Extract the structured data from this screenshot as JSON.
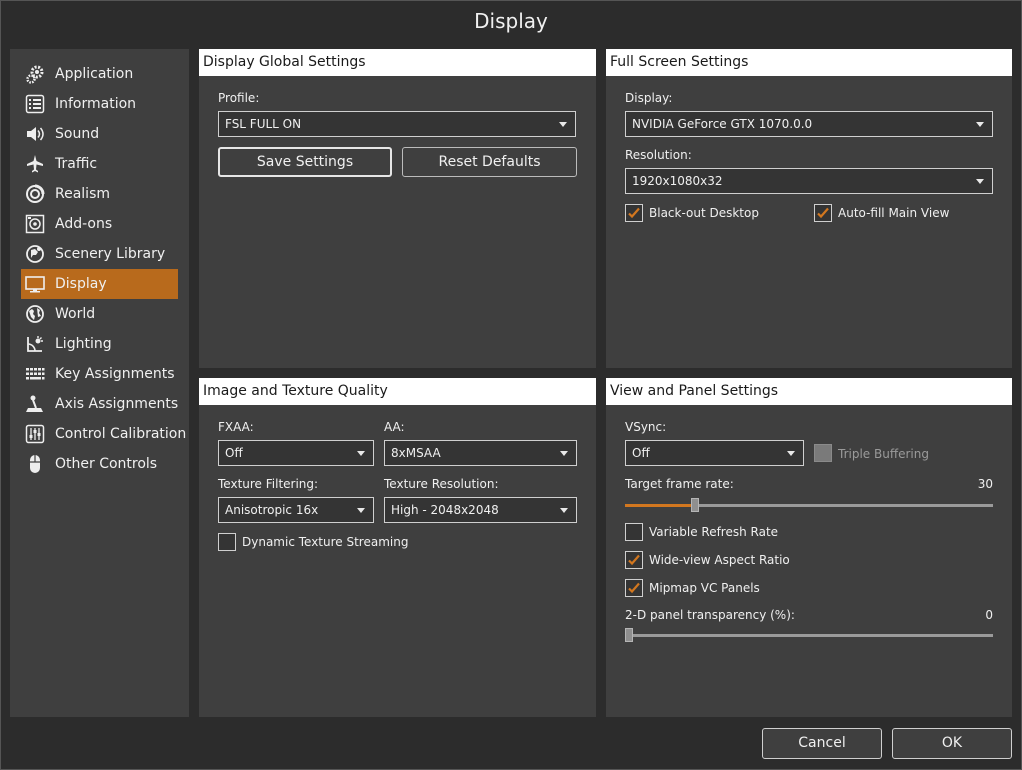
{
  "window": {
    "title": "Display"
  },
  "sidebar": {
    "active_color": "#b86a1c",
    "items": [
      {
        "label": "Application",
        "icon": "gears-icon"
      },
      {
        "label": "Information",
        "icon": "list-icon"
      },
      {
        "label": "Sound",
        "icon": "speaker-icon"
      },
      {
        "label": "Traffic",
        "icon": "airplane-icon"
      },
      {
        "label": "Realism",
        "icon": "realism-icon"
      },
      {
        "label": "Add-ons",
        "icon": "addons-icon"
      },
      {
        "label": "Scenery Library",
        "icon": "globe-pin-icon"
      },
      {
        "label": "Display",
        "icon": "monitor-icon",
        "active": true
      },
      {
        "label": "World",
        "icon": "world-icon"
      },
      {
        "label": "Lighting",
        "icon": "lighting-icon"
      },
      {
        "label": "Key Assignments",
        "icon": "keyboard-icon"
      },
      {
        "label": "Axis Assignments",
        "icon": "joystick-icon"
      },
      {
        "label": "Control Calibration",
        "icon": "sliders-icon"
      },
      {
        "label": "Other Controls",
        "icon": "mouse-icon"
      }
    ]
  },
  "global": {
    "header": "Display Global Settings",
    "profile_label": "Profile:",
    "profile_value": "FSL FULL ON",
    "save_button": "Save Settings",
    "reset_button": "Reset Defaults"
  },
  "fullscreen": {
    "header": "Full Screen Settings",
    "display_label": "Display:",
    "display_value": "NVIDIA GeForce GTX 1070.0.0",
    "resolution_label": "Resolution:",
    "resolution_value": "1920x1080x32",
    "blackout_label": "Black-out Desktop",
    "blackout_checked": true,
    "autofill_label": "Auto-fill Main View",
    "autofill_checked": true
  },
  "image": {
    "header": "Image and Texture Quality",
    "fxaa_label": "FXAA:",
    "fxaa_value": "Off",
    "aa_label": "AA:",
    "aa_value": "8xMSAA",
    "filtering_label": "Texture Filtering:",
    "filtering_value": "Anisotropic 16x",
    "texres_label": "Texture Resolution:",
    "texres_value": "High - 2048x2048",
    "streaming_label": "Dynamic Texture Streaming",
    "streaming_checked": false
  },
  "view": {
    "header": "View and Panel Settings",
    "vsync_label": "VSync:",
    "vsync_value": "Off",
    "triple_label": "Triple Buffering",
    "triple_checked": false,
    "target_label": "Target frame rate:",
    "target_value": "30",
    "target_fraction": 0.19,
    "vrr_label": "Variable Refresh Rate",
    "vrr_checked": false,
    "wide_label": "Wide-view Aspect Ratio",
    "wide_checked": true,
    "mipmap_label": "Mipmap VC Panels",
    "mipmap_checked": true,
    "transparency_label": "2-D panel transparency (%):",
    "transparency_value": "0",
    "transparency_fraction": 0.0
  },
  "footer": {
    "cancel": "Cancel",
    "ok": "OK"
  },
  "colors": {
    "accent": "#d2771f",
    "panel": "#3f3f3f",
    "background": "#2c2c2c"
  }
}
